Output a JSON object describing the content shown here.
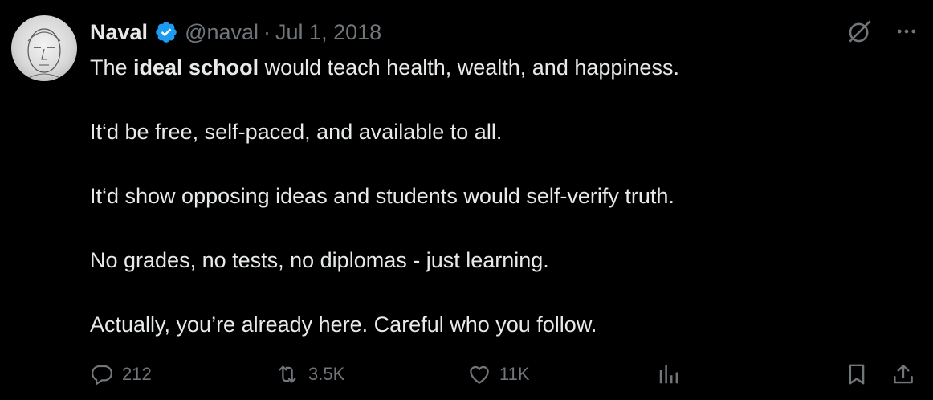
{
  "tweet": {
    "author": {
      "display_name": "Naval",
      "verified": true,
      "handle": "@naval",
      "separator": "·",
      "date": "Jul 1, 2018"
    },
    "body": {
      "line1_before": "The ",
      "line1_bold": "ideal school",
      "line1_after": " would teach health, wealth, and happiness.",
      "line2": "It‘d be free, self-paced, and available to all.",
      "line3": "It‘d show opposing ideas and students would self-verify truth.",
      "line4": "No grades, no tests, no diplomas - just learning.",
      "line5": "Actually, you’re already here. Careful who you follow."
    },
    "stats": {
      "replies": "212",
      "reposts": "3.5K",
      "likes": "11K"
    },
    "icons": {
      "top_right": [
        "grok-icon",
        "more-icon"
      ],
      "actions": [
        "reply-icon",
        "repost-icon",
        "like-icon",
        "views-icon",
        "bookmark-icon",
        "share-icon"
      ]
    },
    "colors": {
      "background": "#000000",
      "text": "#e7e9ea",
      "secondary": "#71767b",
      "verified": "#1d9bf0"
    }
  }
}
